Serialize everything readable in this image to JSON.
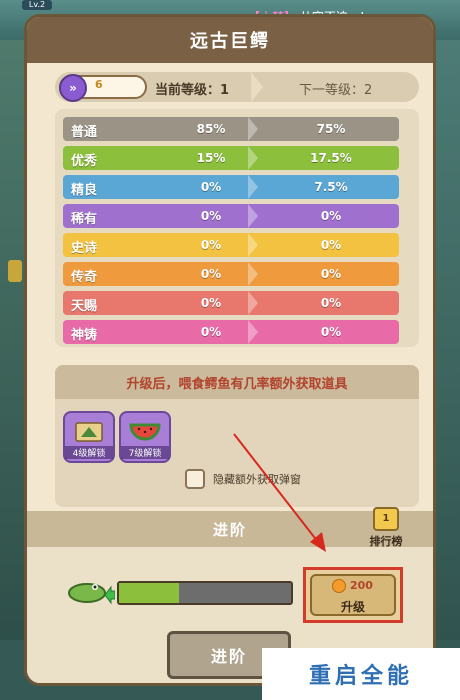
{
  "background": {
    "level_tag": "Lv.2",
    "chat": {
      "name": "【小梦】",
      "message": "从容不迫，!"
    }
  },
  "panel": {
    "title": "远古巨鳄",
    "level_chip_value": "6",
    "current_level_text": "当前等级：1",
    "next_level_text": "下一等级：2"
  },
  "rarity": {
    "rows": [
      {
        "name": "普通",
        "current": "85%",
        "next": "75%",
        "color": "#9b9486"
      },
      {
        "name": "优秀",
        "current": "15%",
        "next": "17.5%",
        "color": "#8cbf3b"
      },
      {
        "name": "精良",
        "current": "0%",
        "next": "7.5%",
        "color": "#5aa6d4"
      },
      {
        "name": "稀有",
        "current": "0%",
        "next": "0%",
        "color": "#a070cf"
      },
      {
        "name": "史诗",
        "current": "0%",
        "next": "0%",
        "color": "#f2c240"
      },
      {
        "name": "传奇",
        "current": "0%",
        "next": "0%",
        "color": "#ef9a3c"
      },
      {
        "name": "天赐",
        "current": "0%",
        "next": "0%",
        "color": "#e8786e"
      },
      {
        "name": "神铸",
        "current": "0%",
        "next": "0%",
        "color": "#e86aa6"
      }
    ]
  },
  "bonus": {
    "title": "升级后，喂食鳄鱼有几率额外获取道具",
    "items": [
      {
        "label": "4级解锁",
        "icon": "scroll-icon"
      },
      {
        "label": "7级解锁",
        "icon": "watermelon-icon"
      }
    ],
    "checkbox_label": "隐藏额外获取弹窗"
  },
  "advance": {
    "title": "进阶",
    "rank_label": "排行榜",
    "rank_badge": "1",
    "progress": 0.35,
    "upgrade_cost": "200",
    "upgrade_label": "升级",
    "advance_button": "进阶"
  },
  "watermark": "重启全能"
}
